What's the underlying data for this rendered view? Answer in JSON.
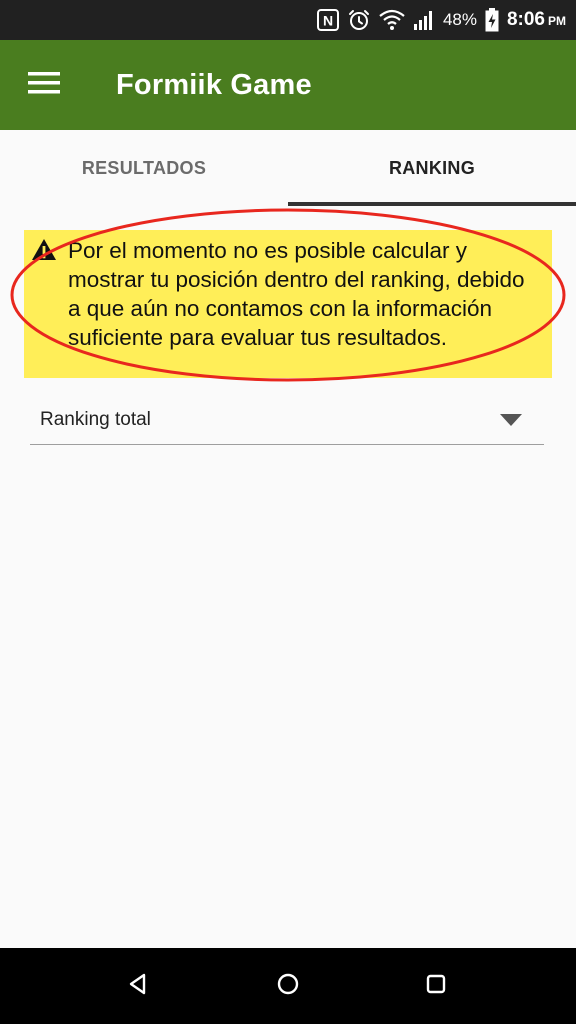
{
  "status_bar": {
    "icons": [
      "nfc-icon",
      "alarm-icon",
      "wifi-icon",
      "signal-icon"
    ],
    "battery_percent": "48%",
    "time": "8:06",
    "ampm": "PM"
  },
  "app_bar": {
    "menu_icon": "hamburger-menu-icon",
    "title": "Formiik Game",
    "background_color": "#4a7d1f"
  },
  "tabs": [
    {
      "label": "RESULTADOS",
      "active": false
    },
    {
      "label": "RANKING",
      "active": true
    }
  ],
  "warning": {
    "icon": "warning-triangle-icon",
    "message": "Por el momento no es posible calcular y mostrar tu posición dentro del ranking, debido a que aún no contamos con la información suficiente para evaluar tus resultados.",
    "background_color": "#ffee58",
    "annotation_color": "#e8271e"
  },
  "ranking_select": {
    "selected": "Ranking total",
    "arrow_icon": "dropdown-arrow-icon"
  },
  "nav_bar": {
    "buttons": [
      "back-icon",
      "home-icon",
      "recents-icon"
    ]
  }
}
